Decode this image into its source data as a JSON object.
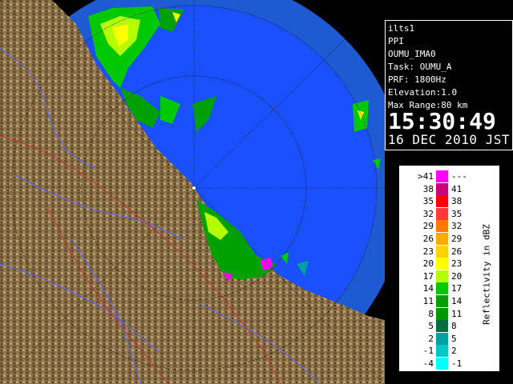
{
  "info": {
    "site": "ilts1",
    "mode": "PPI",
    "scan": "OUMU_IMA0",
    "task": "Task: OUMU_A",
    "prf": "PRF: 1800Hz",
    "elevation": "Elevation:1.0",
    "max_range": "Max Range:80 km",
    "time": "15:30:49",
    "date": "16 DEC 2010 JST"
  },
  "legend": {
    "unit": "Reflectivity in dBZ",
    "rows": [
      {
        "lo": ">41",
        "hi": "---",
        "color": "#ff00ff"
      },
      {
        "lo": "38",
        "hi": "41",
        "color": "#c8007a"
      },
      {
        "lo": "35",
        "hi": "38",
        "color": "#ff0000"
      },
      {
        "lo": "32",
        "hi": "35",
        "color": "#ff3a3a"
      },
      {
        "lo": "29",
        "hi": "32",
        "color": "#ff7a00"
      },
      {
        "lo": "26",
        "hi": "29",
        "color": "#ffa800"
      },
      {
        "lo": "23",
        "hi": "26",
        "color": "#ffd200"
      },
      {
        "lo": "20",
        "hi": "23",
        "color": "#ffff00"
      },
      {
        "lo": "17",
        "hi": "20",
        "color": "#b4ff00"
      },
      {
        "lo": "14",
        "hi": "17",
        "color": "#00c800"
      },
      {
        "lo": "11",
        "hi": "14",
        "color": "#00a000"
      },
      {
        "lo": "8",
        "hi": "11",
        "color": "#009600"
      },
      {
        "lo": "5",
        "hi": "8",
        "color": "#006e3c"
      },
      {
        "lo": "2",
        "hi": "5",
        "color": "#00a0a0"
      },
      {
        "lo": "-1",
        "hi": "2",
        "color": "#00c8c8"
      },
      {
        "lo": "-4",
        "hi": "-1",
        "color": "#00ffff"
      }
    ]
  },
  "colors": {
    "sea_outer": "#1e5ad2",
    "sea_inner": "#1a50ff",
    "land": "#8a6e46",
    "river": "#5a64ff",
    "border": "#c83232"
  }
}
